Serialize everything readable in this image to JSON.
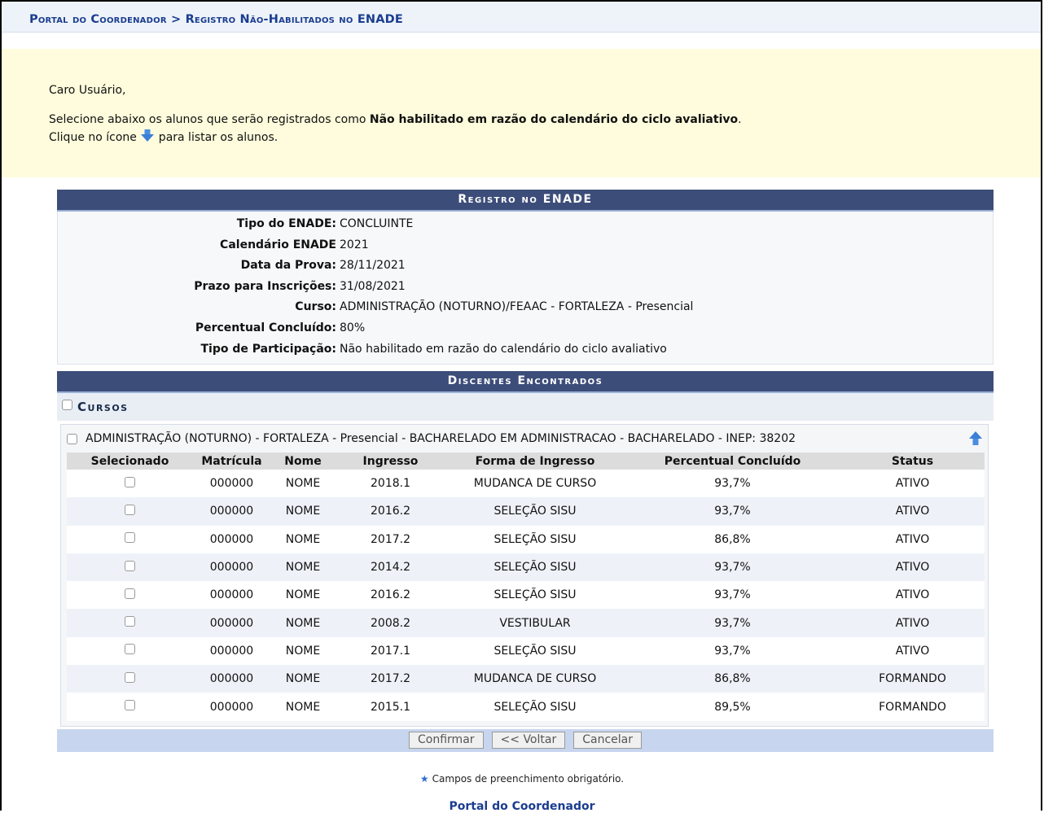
{
  "breadcrumb": "Portal do Coordenador > Registro Não-Habilitados no ENADE",
  "notice": {
    "greeting": "Caro Usuário,",
    "line1_prefix": "Selecione abaixo os alunos que serão registrados como ",
    "line1_bold": "Não habilitado em razão do calendário do ciclo avaliativo",
    "line1_suffix": ".",
    "line2_prefix": "Clique no ícone",
    "line2_suffix": " para listar os alunos.",
    "icon": "arrow-down-icon"
  },
  "registro": {
    "title": "Registro no ENADE",
    "rows": [
      {
        "label": "Tipo do ENADE:",
        "value": "CONCLUINTE"
      },
      {
        "label": "Calendário ENADE",
        "value": "2021"
      },
      {
        "label": "Data da Prova:",
        "value": "28/11/2021"
      },
      {
        "label": "Prazo para Inscrições:",
        "value": "31/08/2021"
      },
      {
        "label": "Curso:",
        "value": "ADMINISTRAÇÃO (NOTURNO)/FEAAC - FORTALEZA - Presencial"
      },
      {
        "label": "Percentual Concluído:",
        "value": "80%"
      },
      {
        "label": "Tipo de Participação:",
        "value": "Não habilitado em razão do calendário do ciclo avaliativo"
      }
    ]
  },
  "discentes": {
    "title": "Discentes Encontrados",
    "cursos_label": "Cursos",
    "course_name": "ADMINISTRAÇÃO (NOTURNO) - FORTALEZA - Presencial - BACHARELADO EM ADMINISTRACAO - BACHARELADO - INEP: 38202",
    "columns": [
      "Selecionado",
      "Matrícula",
      "Nome",
      "Ingresso",
      "Forma de Ingresso",
      "Percentual Concluído",
      "Status"
    ],
    "rows": [
      {
        "matricula": "000000",
        "nome": "NOME",
        "ingresso": "2018.1",
        "forma": "MUDANCA DE CURSO",
        "percentual": "93,7%",
        "status": "ATIVO"
      },
      {
        "matricula": "000000",
        "nome": "NOME",
        "ingresso": "2016.2",
        "forma": "SELEÇÃO SISU",
        "percentual": "93,7%",
        "status": "ATIVO"
      },
      {
        "matricula": "000000",
        "nome": "NOME",
        "ingresso": "2017.2",
        "forma": "SELEÇÃO SISU",
        "percentual": "86,8%",
        "status": "ATIVO"
      },
      {
        "matricula": "000000",
        "nome": "NOME",
        "ingresso": "2014.2",
        "forma": "SELEÇÃO SISU",
        "percentual": "93,7%",
        "status": "ATIVO"
      },
      {
        "matricula": "000000",
        "nome": "NOME",
        "ingresso": "2016.2",
        "forma": "SELEÇÃO SISU",
        "percentual": "93,7%",
        "status": "ATIVO"
      },
      {
        "matricula": "000000",
        "nome": "NOME",
        "ingresso": "2008.2",
        "forma": "VESTIBULAR",
        "percentual": "93,7%",
        "status": "ATIVO"
      },
      {
        "matricula": "000000",
        "nome": "NOME",
        "ingresso": "2017.1",
        "forma": "SELEÇÃO SISU",
        "percentual": "93,7%",
        "status": "ATIVO"
      },
      {
        "matricula": "000000",
        "nome": "NOME",
        "ingresso": "2017.2",
        "forma": "MUDANCA DE CURSO",
        "percentual": "86,8%",
        "status": "FORMANDO"
      },
      {
        "matricula": "000000",
        "nome": "NOME",
        "ingresso": "2015.1",
        "forma": "SELEÇÃO SISU",
        "percentual": "89,5%",
        "status": "FORMANDO"
      }
    ],
    "buttons": {
      "confirmar": "Confirmar",
      "voltar": "<< Voltar",
      "cancelar": "Cancelar"
    }
  },
  "footer": {
    "required_note": "Campos de preenchimento obrigatório.",
    "portal_link": "Portal do Coordenador"
  },
  "colors": {
    "panel_header": "#3d4d7a",
    "breadcrumb_text": "#1a3d8f",
    "notice_bg": "#fefcdc",
    "button_bar": "#c7d5ee"
  }
}
